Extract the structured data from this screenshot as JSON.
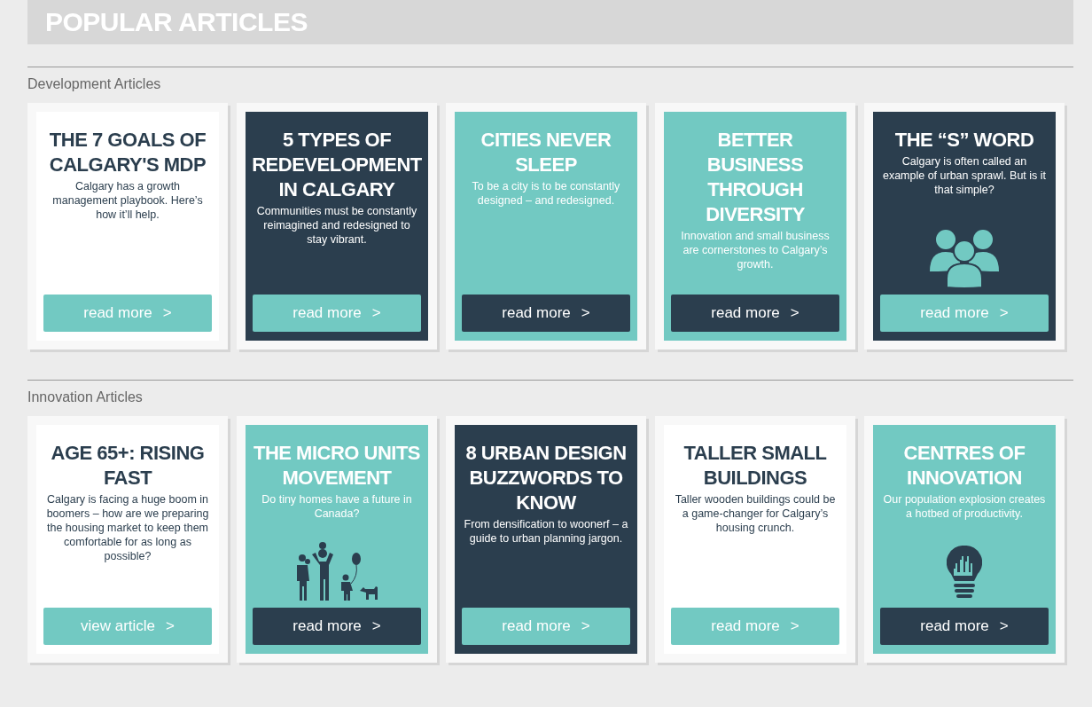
{
  "page_title": "POPULAR ARTICLES",
  "sections": [
    {
      "heading": "Development Articles",
      "cards": [
        {
          "kind": "light",
          "title": "THE 7 GOALS OF CALGARY'S MDP",
          "summary": "Calgary has a growth management playbook. Here’s how it’ll help.",
          "button": "read more",
          "arrow": ">"
        },
        {
          "kind": "dark",
          "title": "5 TYPES OF REDEVELOPMENT IN CALGARY",
          "summary": "Communities must be constantly reimagined and redesigned to stay vibrant.",
          "button": "read more",
          "arrow": ">"
        },
        {
          "kind": "accent",
          "title": "CITIES NEVER SLEEP",
          "summary": "To be a city is to be constantly designed – and redesigned.",
          "button": "read more",
          "arrow": ">"
        },
        {
          "kind": "accent",
          "title": "BETTER BUSINESS THROUGH DIVERSITY",
          "summary": "Innovation and small business are cornerstones to Calgary’s growth.",
          "button": "read more",
          "arrow": ">"
        },
        {
          "kind": "dark",
          "title": "THE “S” WORD",
          "summary": "Calgary is often called an example of urban sprawl. But is it that simple?",
          "button": "read more",
          "arrow": ">",
          "icon": {
            "kind": "people"
          }
        }
      ]
    },
    {
      "heading": "Innovation Articles",
      "cards": [
        {
          "kind": "light",
          "title": "AGE 65+: RISING FAST",
          "summary": "Calgary is facing a huge boom in boomers – how are we preparing the housing market to keep them comfortable for as long as possible?",
          "button": "view article",
          "arrow": ">"
        },
        {
          "kind": "accent",
          "title": "THE MICRO UNITS MOVEMENT",
          "summary": "Do tiny homes have a future in Canada?",
          "button": "read more",
          "arrow": ">",
          "icon": {
            "kind": "family"
          }
        },
        {
          "kind": "dark",
          "title": "8 URBAN DESIGN BUZZWORDS TO KNOW",
          "summary": "From densification to woonerf – a guide to urban planning jargon.",
          "button": "read more",
          "arrow": ">"
        },
        {
          "kind": "light",
          "title": "TALLER SMALL BUILDINGS",
          "summary": "Taller wooden buildings could be a game-changer for Calgary’s housing crunch.",
          "button": "read more",
          "arrow": ">"
        },
        {
          "kind": "accent",
          "title": "CENTRES OF INNOVATION",
          "summary": "Our population explosion creates a hotbed of productivity.",
          "button": "read more",
          "arrow": ">",
          "icon": {
            "kind": "bulb"
          }
        }
      ]
    }
  ]
}
